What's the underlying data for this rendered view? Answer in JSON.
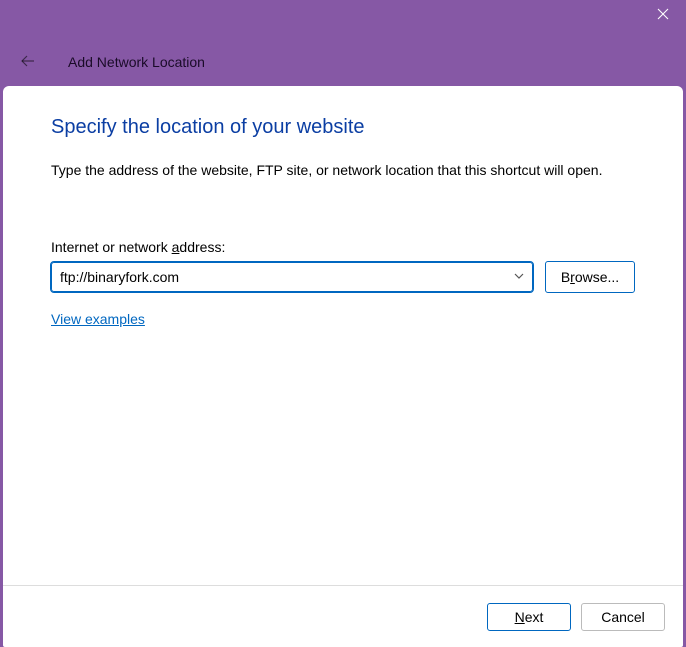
{
  "window": {
    "title": "Add Network Location"
  },
  "page": {
    "heading": "Specify the location of your website",
    "description": "Type the address of the website, FTP site, or network location that this shortcut will open.",
    "address_label_pre": "Internet or network ",
    "address_label_u": "a",
    "address_label_post": "ddress:",
    "address_value": "ftp://binaryfork.com",
    "browse_pre": "B",
    "browse_u": "r",
    "browse_post": "owse...",
    "examples": "View examples"
  },
  "footer": {
    "next_u": "N",
    "next_post": "ext",
    "cancel": "Cancel"
  }
}
